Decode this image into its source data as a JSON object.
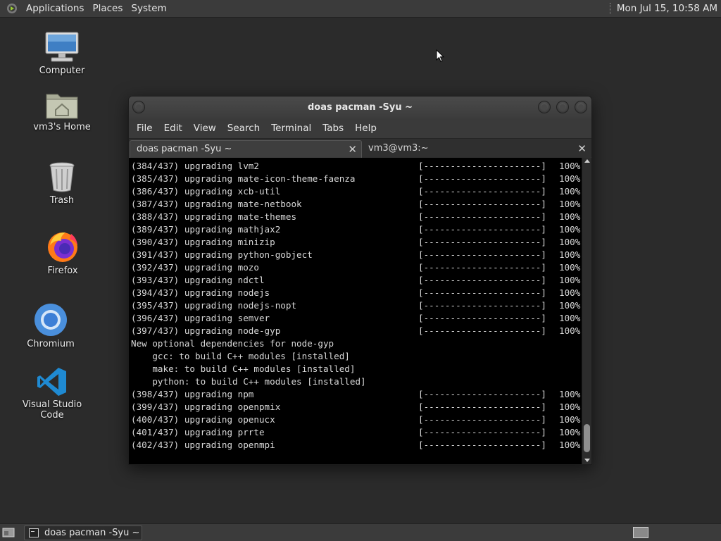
{
  "top_panel": {
    "menus": [
      "Applications",
      "Places",
      "System"
    ],
    "clock": "Mon Jul 15, 10:58 AM"
  },
  "desktop_icons": [
    {
      "label": "Computer",
      "icon": "computer-icon"
    },
    {
      "label": "vm3's Home",
      "icon": "home-folder-icon"
    },
    {
      "label": "Trash",
      "icon": "trash-icon"
    },
    {
      "label": "Firefox",
      "icon": "firefox-icon"
    },
    {
      "label": "Chromium",
      "icon": "chromium-icon"
    },
    {
      "label": "Visual Studio Code",
      "icon": "vscode-icon"
    }
  ],
  "window": {
    "title": "doas pacman -Syu ~",
    "menu": [
      "File",
      "Edit",
      "View",
      "Search",
      "Terminal",
      "Tabs",
      "Help"
    ],
    "tabs": [
      {
        "label": "doas pacman -Syu ~",
        "active": true
      },
      {
        "label": "vm3@vm3:~",
        "active": false
      }
    ]
  },
  "terminal": {
    "lines": [
      {
        "text": "(384/437) upgrading lvm2",
        "bar": "[----------------------]",
        "pct": "100%"
      },
      {
        "text": "(385/437) upgrading mate-icon-theme-faenza",
        "bar": "[----------------------]",
        "pct": "100%"
      },
      {
        "text": "(386/437) upgrading xcb-util",
        "bar": "[----------------------]",
        "pct": "100%"
      },
      {
        "text": "(387/437) upgrading mate-netbook",
        "bar": "[----------------------]",
        "pct": "100%"
      },
      {
        "text": "(388/437) upgrading mate-themes",
        "bar": "[----------------------]",
        "pct": "100%"
      },
      {
        "text": "(389/437) upgrading mathjax2",
        "bar": "[----------------------]",
        "pct": "100%"
      },
      {
        "text": "(390/437) upgrading minizip",
        "bar": "[----------------------]",
        "pct": "100%"
      },
      {
        "text": "(391/437) upgrading python-gobject",
        "bar": "[----------------------]",
        "pct": "100%"
      },
      {
        "text": "(392/437) upgrading mozo",
        "bar": "[----------------------]",
        "pct": "100%"
      },
      {
        "text": "(393/437) upgrading ndctl",
        "bar": "[----------------------]",
        "pct": "100%"
      },
      {
        "text": "(394/437) upgrading nodejs",
        "bar": "[----------------------]",
        "pct": "100%"
      },
      {
        "text": "(395/437) upgrading nodejs-nopt",
        "bar": "[----------------------]",
        "pct": "100%"
      },
      {
        "text": "(396/437) upgrading semver",
        "bar": "[----------------------]",
        "pct": "100%"
      },
      {
        "text": "(397/437) upgrading node-gyp",
        "bar": "[----------------------]",
        "pct": "100%"
      },
      {
        "text": "New optional dependencies for node-gyp",
        "bar": "",
        "pct": ""
      },
      {
        "text": "    gcc: to build C++ modules [installed]",
        "bar": "",
        "pct": ""
      },
      {
        "text": "    make: to build C++ modules [installed]",
        "bar": "",
        "pct": ""
      },
      {
        "text": "    python: to build C++ modules [installed]",
        "bar": "",
        "pct": ""
      },
      {
        "text": "(398/437) upgrading npm",
        "bar": "[----------------------]",
        "pct": "100%"
      },
      {
        "text": "(399/437) upgrading openpmix",
        "bar": "[----------------------]",
        "pct": "100%"
      },
      {
        "text": "(400/437) upgrading openucx",
        "bar": "[----------------------]",
        "pct": "100%"
      },
      {
        "text": "(401/437) upgrading prrte",
        "bar": "[----------------------]",
        "pct": "100%"
      },
      {
        "text": "(402/437) upgrading openmpi",
        "bar": "[----------------------]",
        "pct": "100%"
      }
    ]
  },
  "taskbar": {
    "tasks": [
      {
        "label": "doas pacman -Syu ~",
        "icon": "terminal-icon"
      }
    ]
  },
  "colors": {
    "desktop_bg": "#2b2b2b",
    "panel_bg": "#3b3b3b",
    "terminal_bg": "#000000",
    "terminal_fg": "#d8d8d8"
  }
}
